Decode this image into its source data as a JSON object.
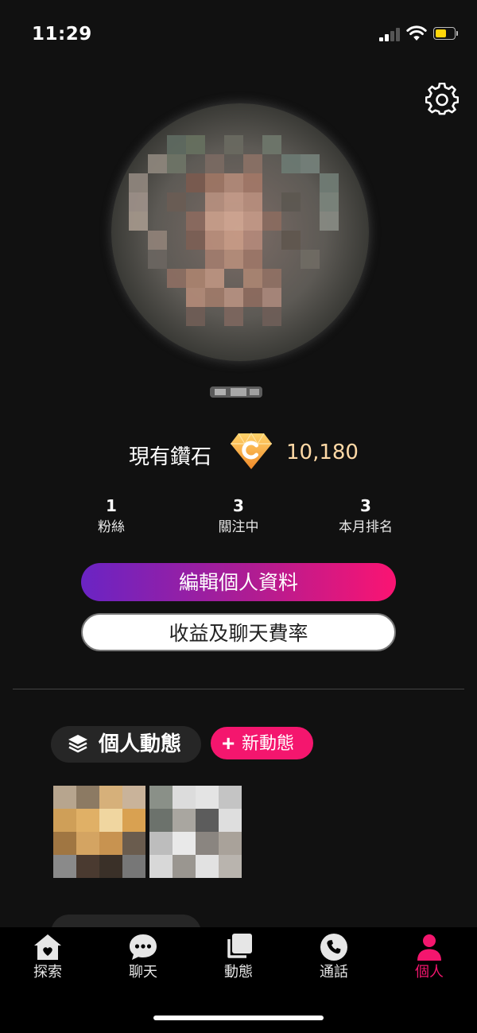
{
  "status_bar": {
    "time": "11:29"
  },
  "profile": {
    "diamond_label": "現有鑽石",
    "diamond_count": "10,180"
  },
  "stats": [
    {
      "value": "1",
      "label": "粉絲"
    },
    {
      "value": "3",
      "label": "關注中"
    },
    {
      "value": "3",
      "label": "本月排名"
    }
  ],
  "buttons": {
    "edit_profile": "編輯個人資料",
    "earnings": "收益及聊天費率"
  },
  "posts_section": {
    "title": "個人動態",
    "new_post_plus": "+",
    "new_post_label": "新動態"
  },
  "tabs": [
    {
      "label": "探索",
      "icon": "home-heart-icon"
    },
    {
      "label": "聊天",
      "icon": "chat-bubble-icon"
    },
    {
      "label": "動態",
      "icon": "stacked-cards-icon"
    },
    {
      "label": "通話",
      "icon": "phone-icon"
    },
    {
      "label": "個人",
      "icon": "person-icon"
    }
  ],
  "colors": {
    "background": "#111111",
    "accent_pink": "#f4166e",
    "gradient_start": "#6a24c4",
    "gradient_end": "#fb1472",
    "diamond_value": "#ffd9a6"
  }
}
